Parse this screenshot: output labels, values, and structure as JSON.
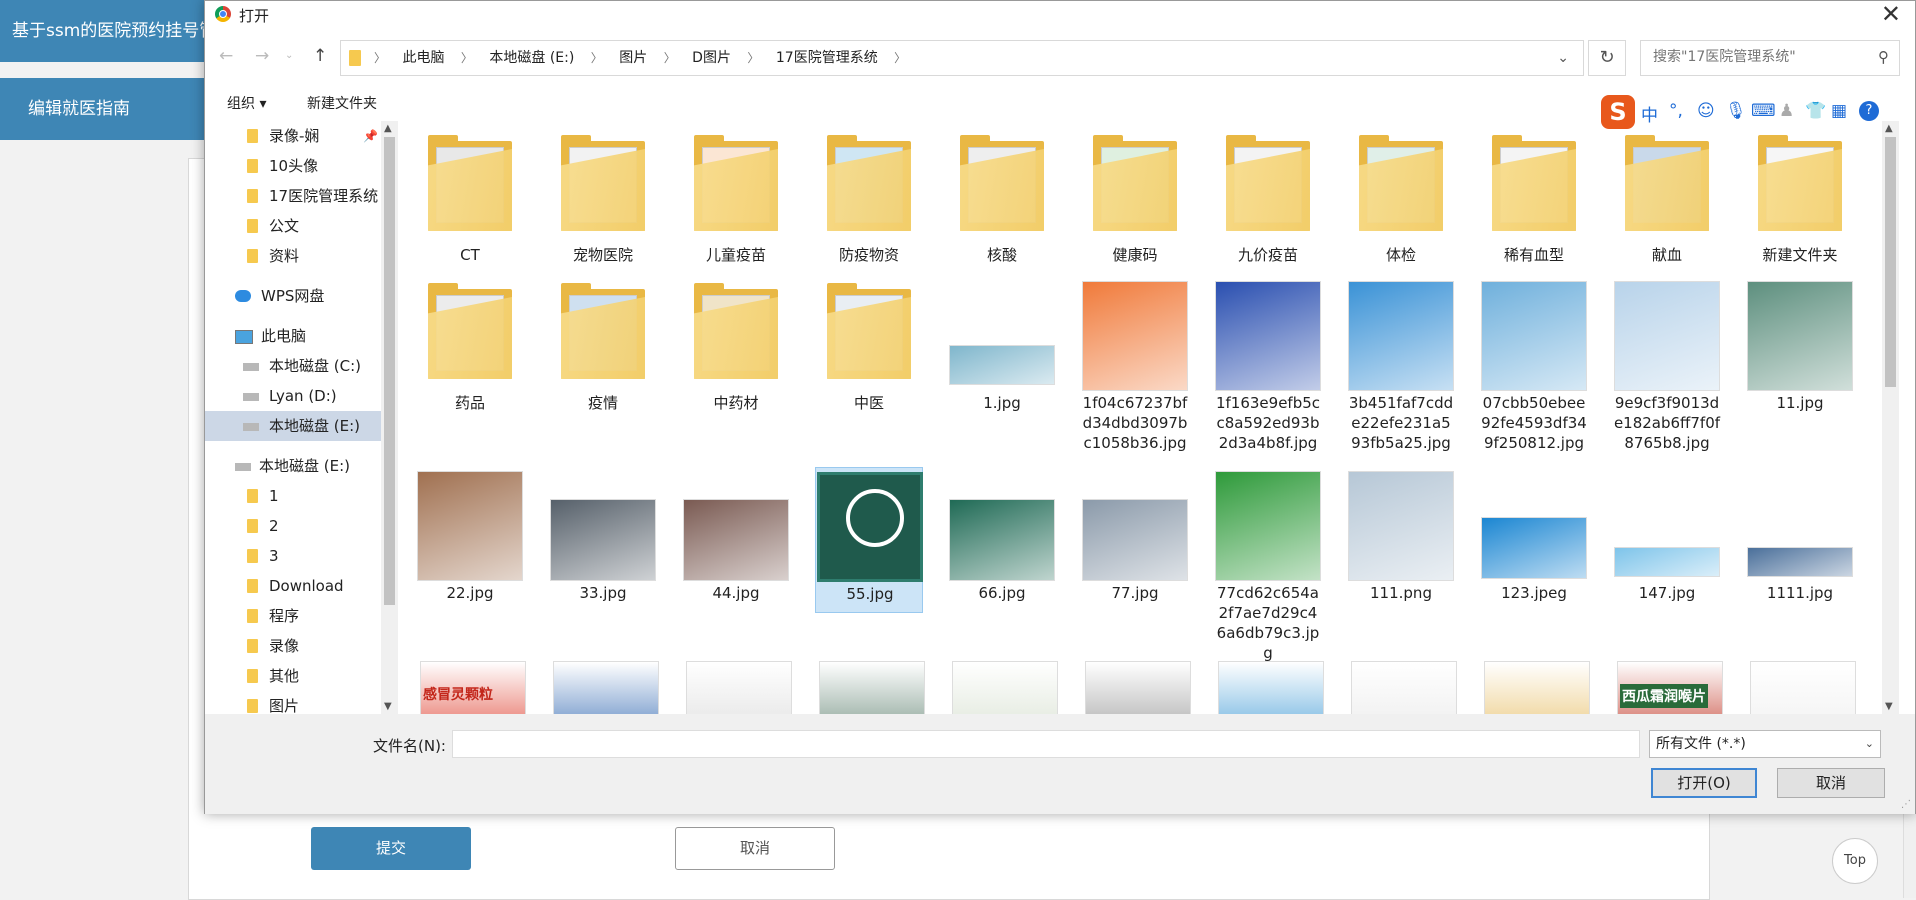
{
  "page": {
    "header_title": "基于ssm的医院预约挂号管",
    "menu_item": "编辑就医指南",
    "submit_label": "提交",
    "cancel_label": "取消",
    "top_label": "Top"
  },
  "dialog": {
    "title": "打开",
    "close": "✕",
    "address": [
      "此电脑",
      "本地磁盘 (E:)",
      "图片",
      "D图片",
      "17医院管理系统"
    ],
    "search_placeholder": "搜索\"17医院管理系统\"",
    "organize": "组织 ▾",
    "new_folder": "新建文件夹",
    "ime_logo": "S",
    "ime_mode": "中",
    "tree": [
      {
        "label": "录像-娴",
        "type": "folder",
        "pinned": true
      },
      {
        "label": "10头像",
        "type": "folder"
      },
      {
        "label": "17医院管理系统",
        "type": "folder"
      },
      {
        "label": "公文",
        "type": "folder"
      },
      {
        "label": "资料",
        "type": "folder"
      },
      {
        "label": "WPS网盘",
        "type": "cloud"
      },
      {
        "label": "此电脑",
        "type": "pc"
      },
      {
        "label": "本地磁盘 (C:)",
        "type": "drive"
      },
      {
        "label": "Lyan (D:)",
        "type": "drive"
      },
      {
        "label": "本地磁盘 (E:)",
        "type": "drive",
        "selected": true
      },
      {
        "label": "本地磁盘 (E:)",
        "type": "drive"
      },
      {
        "label": "1",
        "type": "folder"
      },
      {
        "label": "2",
        "type": "folder"
      },
      {
        "label": "3",
        "type": "folder"
      },
      {
        "label": "Download",
        "type": "folder"
      },
      {
        "label": "程序",
        "type": "folder"
      },
      {
        "label": "录像",
        "type": "folder"
      },
      {
        "label": "其他",
        "type": "folder"
      },
      {
        "label": "图片",
        "type": "folder"
      }
    ],
    "files": [
      {
        "name": "CT",
        "type": "folder"
      },
      {
        "name": "宠物医院",
        "type": "folder"
      },
      {
        "name": "儿童疫苗",
        "type": "folder"
      },
      {
        "name": "防疫物资",
        "type": "folder"
      },
      {
        "name": "核酸",
        "type": "folder"
      },
      {
        "name": "健康码",
        "type": "folder"
      },
      {
        "name": "九价疫苗",
        "type": "folder"
      },
      {
        "name": "体检",
        "type": "folder"
      },
      {
        "name": "稀有血型",
        "type": "folder"
      },
      {
        "name": "献血",
        "type": "folder"
      },
      {
        "name": "新建文件夹",
        "type": "folder"
      },
      {
        "name": "药品",
        "type": "folder"
      },
      {
        "name": "疫情",
        "type": "folder"
      },
      {
        "name": "中药材",
        "type": "folder"
      },
      {
        "name": "中医",
        "type": "folder"
      },
      {
        "name": "1.jpg",
        "type": "image",
        "color": "#7fb6cc"
      },
      {
        "name": "1f04c67237bfd34dbd3097bc1058b36.jpg",
        "type": "image",
        "color": "#f07a3a"
      },
      {
        "name": "1f163e9efb5cc8a592ed93b2d3a4b8f.jpg",
        "type": "image",
        "color": "#2a4fb0"
      },
      {
        "name": "3b451faf7cdde22efe231a593fb5a25.jpg",
        "type": "image",
        "color": "#3a92d6"
      },
      {
        "name": "07cbb50ebee92fe4593df349f250812.jpg",
        "type": "image",
        "color": "#6fb0dc"
      },
      {
        "name": "9e9cf3f9013de182ab6ff7f0f8765b8.jpg",
        "type": "image",
        "color": "#b8d3ea"
      },
      {
        "name": "11.jpg",
        "type": "image",
        "color": "#5d8f7e"
      },
      {
        "name": "22.jpg",
        "type": "image",
        "color": "#a07050"
      },
      {
        "name": "33.jpg",
        "type": "image",
        "color": "#56606a"
      },
      {
        "name": "44.jpg",
        "type": "image",
        "color": "#7a5a52"
      },
      {
        "name": "55.jpg",
        "type": "image",
        "color": "#1f5a4c",
        "selected": true
      },
      {
        "name": "66.jpg",
        "type": "image",
        "color": "#1f6a55"
      },
      {
        "name": "77.jpg",
        "type": "image",
        "color": "#8b9aaa"
      },
      {
        "name": "77cd62c654a2f7ae7d29c46a6db79c3.jpg",
        "type": "image",
        "color": "#2e9a3a"
      },
      {
        "name": "111.png",
        "type": "image",
        "color": "#b6c7d6"
      },
      {
        "name": "123.jpeg",
        "type": "image",
        "color": "#1b86d2"
      },
      {
        "name": "147.jpg",
        "type": "image",
        "color": "#7ec4ea"
      },
      {
        "name": "1111.jpg",
        "type": "image",
        "color": "#4a6f9a"
      }
    ],
    "bottom_row": [
      "#e04a3a",
      "#3b6fb5",
      "#dcdcdc",
      "#6a8a7a",
      "#d7e0d0",
      "#999999",
      "#4aa0d8",
      "#e9e9e9",
      "#e8c06a",
      "#c23a2a",
      "#eeeeee"
    ],
    "bottom_row_texts": [
      "感冒灵颗粒",
      "西瓜霜润喉片"
    ],
    "filename_label": "文件名(N):",
    "filename_value": "",
    "filetype": "所有文件 (*.*)",
    "open_label": "打开(O)",
    "cancel_label": "取消"
  }
}
